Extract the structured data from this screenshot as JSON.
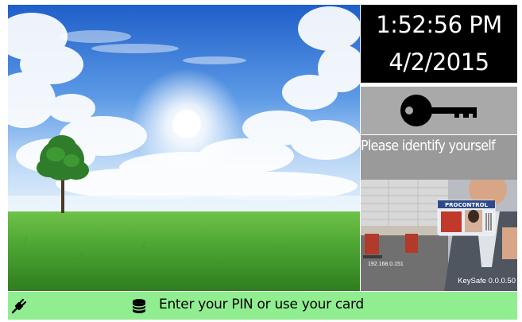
{
  "clock": {
    "time": "1:52:56 PM",
    "date": "4/2/2015"
  },
  "login": {
    "key_icon": "key-icon",
    "identify_text": "Please identify yourself",
    "card_brand": "PROCONTROL",
    "ip_address": "192.168.0.151",
    "version": "KeySafe 0.0.0.50"
  },
  "status_bar": {
    "connection_icon": "plug-icon",
    "database_icon": "database-icon",
    "prompt": "Enter your PIN or use your card"
  },
  "colors": {
    "clock_bg": "#000000",
    "key_tile_bg": "#a9a9a9",
    "identify_bg": "#9a9a9a",
    "status_bar_bg": "#90ee90"
  }
}
